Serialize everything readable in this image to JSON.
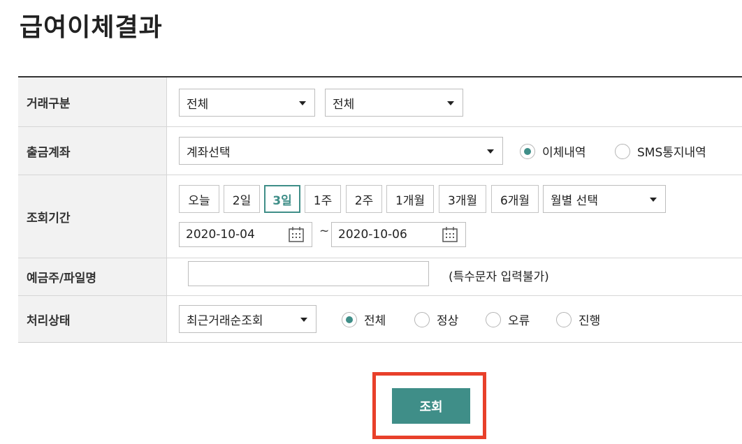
{
  "title": "급여이체결과",
  "rows": {
    "trade_type": {
      "label": "거래구분",
      "select1": "전체",
      "select2": "전체"
    },
    "account": {
      "label": "출금계좌",
      "select": "계좌선택",
      "radio1": "이체내역",
      "radio2": "SMS통지내역"
    },
    "period": {
      "label": "조회기간",
      "buttons": [
        "오늘",
        "2일",
        "3일",
        "1주",
        "2주",
        "1개월",
        "3개월",
        "6개월"
      ],
      "active": "3일",
      "month_select": "월별 선택",
      "start_date": "2020-10-04",
      "end_date": "2020-10-06",
      "separator": "~"
    },
    "depositor": {
      "label": "예금주/파일명",
      "value": "",
      "note": "(특수문자 입력불가)"
    },
    "status": {
      "label": "처리상태",
      "select": "최근거래순조회",
      "options": [
        "전체",
        "정상",
        "오류",
        "진행"
      ],
      "selected": "전체"
    }
  },
  "search_button": "조회",
  "colors": {
    "accent": "#3f8e88",
    "highlight": "#e8402a"
  }
}
